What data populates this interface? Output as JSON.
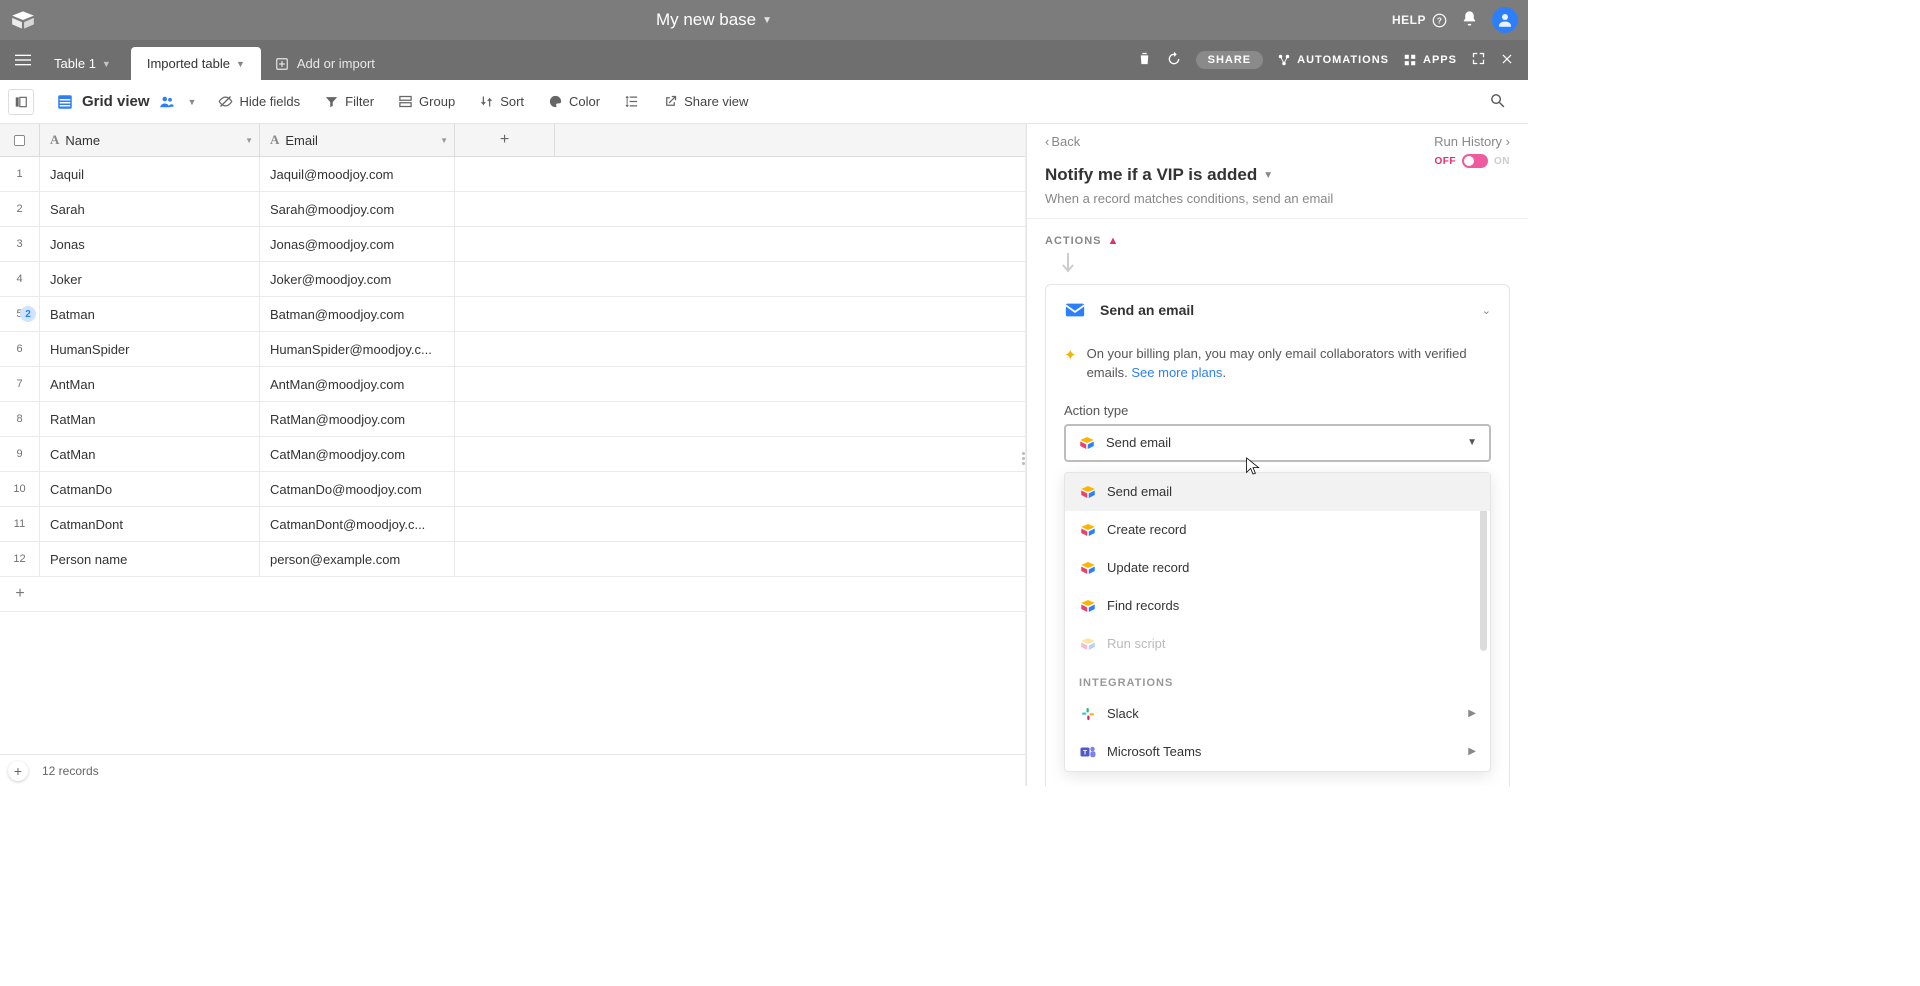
{
  "topbar": {
    "base_title": "My new base",
    "help_label": "HELP"
  },
  "tabs": {
    "items": [
      "Table 1",
      "Imported table"
    ],
    "active_index": 1,
    "add_label": "Add or import"
  },
  "tabsbar": {
    "share_label": "SHARE",
    "automations_label": "AUTOMATIONS",
    "apps_label": "APPS"
  },
  "toolbar": {
    "view_name": "Grid view",
    "hide_fields": "Hide fields",
    "filter": "Filter",
    "group": "Group",
    "sort": "Sort",
    "color": "Color",
    "share_view": "Share view"
  },
  "columns": {
    "name": "Name",
    "email": "Email"
  },
  "rows": [
    {
      "n": "1",
      "name": "Jaquil",
      "email": "Jaquil@moodjoy.com"
    },
    {
      "n": "2",
      "name": "Sarah",
      "email": "Sarah@moodjoy.com"
    },
    {
      "n": "3",
      "name": "Jonas",
      "email": "Jonas@moodjoy.com"
    },
    {
      "n": "4",
      "name": "Joker",
      "email": "Joker@moodjoy.com"
    },
    {
      "n": "5",
      "name": "Batman",
      "email": "Batman@moodjoy.com",
      "badge": "2"
    },
    {
      "n": "6",
      "name": "HumanSpider",
      "email": "HumanSpider@moodjoy.c..."
    },
    {
      "n": "7",
      "name": "AntMan",
      "email": "AntMan@moodjoy.com"
    },
    {
      "n": "8",
      "name": "RatMan",
      "email": "RatMan@moodjoy.com"
    },
    {
      "n": "9",
      "name": "CatMan",
      "email": "CatMan@moodjoy.com"
    },
    {
      "n": "10",
      "name": "CatmanDo",
      "email": "CatmanDo@moodjoy.com"
    },
    {
      "n": "11",
      "name": "CatmanDont",
      "email": "CatmanDont@moodjoy.c..."
    },
    {
      "n": "12",
      "name": "Person name",
      "email": "person@example.com"
    }
  ],
  "footer": {
    "record_count": "12 records"
  },
  "panel": {
    "back": "Back",
    "run_history": "Run History",
    "title": "Notify me if a VIP is added",
    "toggle_off": "OFF",
    "toggle_on": "ON",
    "description": "When a record matches conditions, send an email",
    "actions_label": "ACTIONS",
    "action_card_title": "Send an email",
    "billing_note": "On your billing plan, you may only email collaborators with verified emails. ",
    "see_plans": "See more plans",
    "action_type_label": "Action type",
    "selected_action": "Send email",
    "menu": {
      "items": [
        "Send email",
        "Create record",
        "Update record",
        "Find records",
        "Run script"
      ],
      "integrations_header": "INTEGRATIONS",
      "integrations": [
        "Slack",
        "Microsoft Teams"
      ]
    }
  }
}
